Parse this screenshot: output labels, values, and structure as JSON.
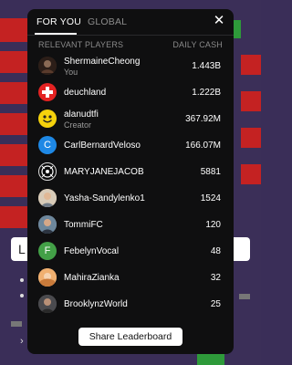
{
  "tabs": {
    "for_you": "FOR YOU",
    "global": "GLOBAL",
    "active": "for_you"
  },
  "columns": {
    "left": "RELEVANT PLAYERS",
    "right": "DAILY CASH"
  },
  "players": [
    {
      "name": "ShermaineCheong",
      "subtitle": "You",
      "value": "1.443B",
      "avatar": "dark-portrait"
    },
    {
      "name": "deuchland",
      "subtitle": "",
      "value": "1.222B",
      "avatar": "swiss-flag"
    },
    {
      "name": "alanudtfi",
      "subtitle": "Creator",
      "value": "367.92M",
      "avatar": "smiley"
    },
    {
      "name": "CarlBernardVeloso",
      "subtitle": "",
      "value": "166.07M",
      "avatar": "letter",
      "letter": "C",
      "color": "#1e88e5"
    },
    {
      "name": "MARYJANEJACOB",
      "subtitle": "",
      "value": "5881",
      "avatar": "emblem"
    },
    {
      "name": "Yasha-Sandylenko1",
      "subtitle": "",
      "value": "1524",
      "avatar": "photo"
    },
    {
      "name": "TommiFC",
      "subtitle": "",
      "value": "120",
      "avatar": "photo-2"
    },
    {
      "name": "FebelynVocal",
      "subtitle": "",
      "value": "48",
      "avatar": "letter",
      "letter": "F",
      "color": "#43a047"
    },
    {
      "name": "MahiraZianka",
      "subtitle": "",
      "value": "32",
      "avatar": "photo-3"
    },
    {
      "name": "BrooklynzWorld",
      "subtitle": "",
      "value": "25",
      "avatar": "photo-4"
    }
  ],
  "share_button": "Share Leaderboard",
  "close_icon": "close-icon",
  "background": {
    "card_letter": "L"
  }
}
